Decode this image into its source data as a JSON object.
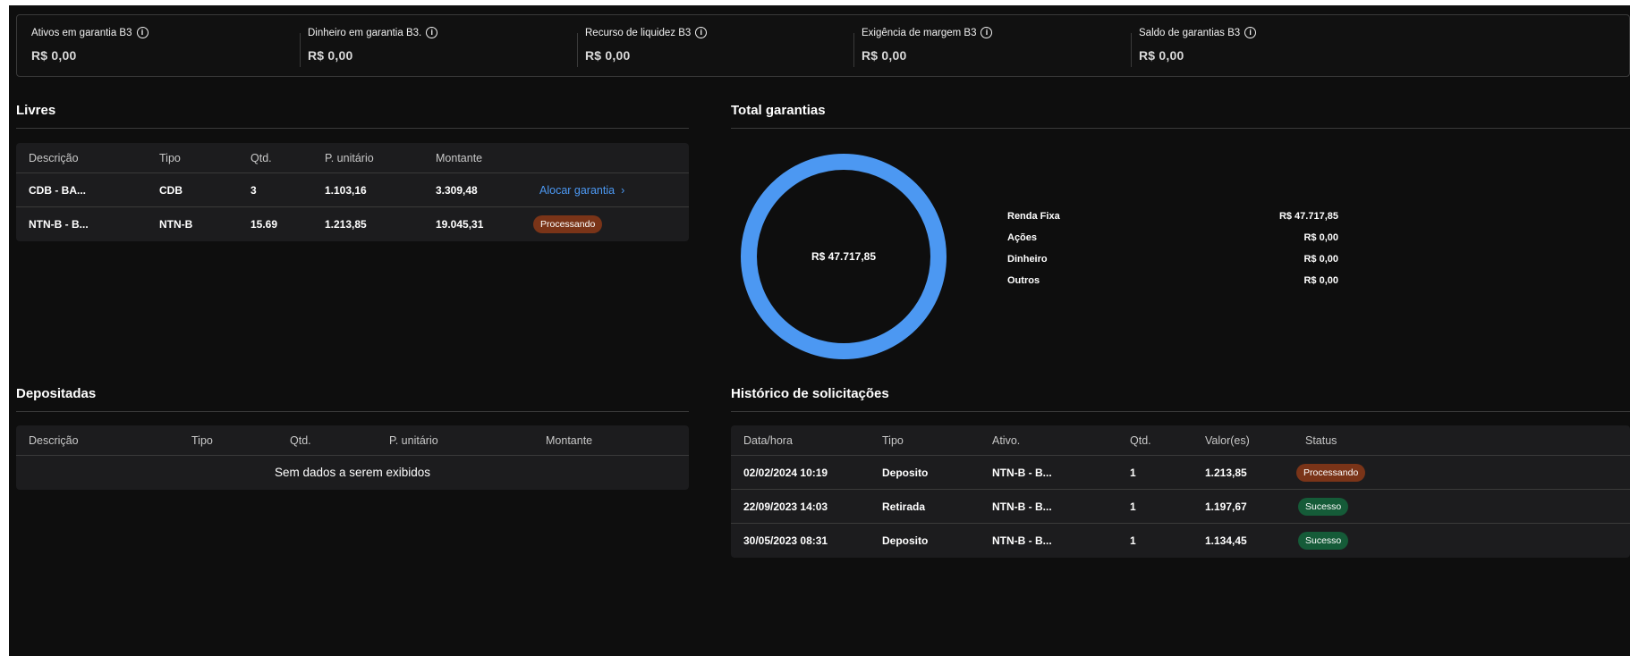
{
  "summary": [
    {
      "label": "Ativos em garantia B3",
      "value": "R$ 0,00"
    },
    {
      "label": "Dinheiro em garantia B3.",
      "value": "R$ 0,00"
    },
    {
      "label": "Recurso de liquidez B3",
      "value": "R$ 0,00"
    },
    {
      "label": "Exigência de margem B3",
      "value": "R$ 0,00"
    },
    {
      "label": "Saldo de garantias B3",
      "value": "R$ 0,00"
    }
  ],
  "livres": {
    "title": "Livres",
    "columns": [
      "Descrição",
      "Tipo",
      "Qtd.",
      "P. unitário",
      "Montante"
    ],
    "rows": [
      {
        "descricao": "CDB - BA...",
        "tipo": "CDB",
        "qtd": "3",
        "p_unitario": "1.103,16",
        "montante": "3.309,48",
        "action": "Alocar garantia",
        "action_icon": "chevron-right-icon"
      },
      {
        "descricao": "NTN-B - B...",
        "tipo": "NTN-B",
        "qtd": "15.69",
        "p_unitario": "1.213,85",
        "montante": "19.045,31",
        "status": "Processando"
      }
    ]
  },
  "total_garantias": {
    "title": "Total garantias",
    "center_label": "R$ 47.717,85",
    "chart_color": "#4c98f2"
  },
  "chart_data": {
    "type": "pie",
    "categories": [
      "Renda Fixa",
      "Ações",
      "Dinheiro",
      "Outros"
    ],
    "values": [
      47717.85,
      0,
      0,
      0
    ],
    "value_labels": [
      "R$ 47.717,85",
      "R$ 0,00",
      "R$ 0,00",
      "R$ 0,00"
    ],
    "center_label": "R$ 47.717,85",
    "legend": "right"
  },
  "depositadas": {
    "title": "Depositadas",
    "columns": [
      "Descrição",
      "Tipo",
      "Qtd.",
      "P. unitário",
      "Montante"
    ],
    "empty_text": "Sem dados a serem exibidos"
  },
  "historico": {
    "title": "Histórico de solicitações",
    "columns": [
      "Data/hora",
      "Tipo",
      "Ativo.",
      "Qtd.",
      "Valor(es)",
      "Status"
    ],
    "rows": [
      {
        "data": "02/02/2024 10:19",
        "tipo": "Deposito",
        "ativo": "NTN-B - B...",
        "qtd": "1",
        "valor": "1.213,85",
        "status": "Processando"
      },
      {
        "data": "22/09/2023 14:03",
        "tipo": "Retirada",
        "ativo": "NTN-B - B...",
        "qtd": "1",
        "valor": "1.197,67",
        "status": "Sucesso"
      },
      {
        "data": "30/05/2023 08:31",
        "tipo": "Deposito",
        "ativo": "NTN-B - B...",
        "qtd": "1",
        "valor": "1.134,45",
        "status": "Sucesso"
      }
    ]
  },
  "colors": {
    "background": "#0e0e0e",
    "panel": "#1c1c1e",
    "accent": "#4c98f2",
    "processing": "#7a3418",
    "success": "#155b38"
  }
}
